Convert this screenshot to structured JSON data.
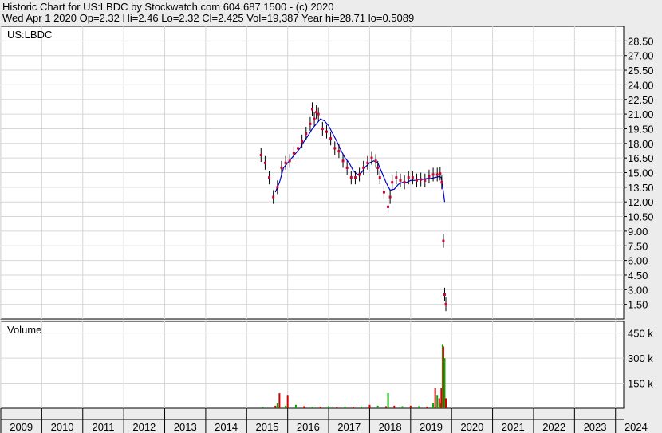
{
  "header": {
    "line1": "Historic Chart for US:LBDC by Stockwatch.com 604.687.1500 - (c) 2020",
    "line2": "Wed Apr  1 2020  Op=2.32  Hi=2.46  Lo=2.32  Cl=2.425  Vol=19,387  Year hi=28.71  lo=0.5089"
  },
  "chart_data": {
    "type": "line",
    "symbol_label": "US:LBDC",
    "volume_label": "Volume",
    "x_tick_labels": [
      "2009",
      "2010",
      "2011",
      "2012",
      "2013",
      "2014",
      "2015",
      "2016",
      "2017",
      "2018",
      "2019",
      "2020",
      "2021",
      "2022",
      "2023",
      "2024"
    ],
    "price_tick_labels": [
      "1.50",
      "3.00",
      "4.50",
      "6.00",
      "7.50",
      "9.00",
      "10.50",
      "12.00",
      "13.50",
      "15.00",
      "16.50",
      "18.00",
      "19.50",
      "21.00",
      "22.50",
      "24.00",
      "25.50",
      "27.00",
      "28.50"
    ],
    "price_ticks": [
      1.5,
      3,
      4.5,
      6,
      7.5,
      9,
      10.5,
      12,
      13.5,
      15,
      16.5,
      18,
      19.5,
      21,
      22.5,
      24,
      25.5,
      27,
      28.5
    ],
    "volume_tick_labels": [
      "150 k",
      "300 k",
      "450 k"
    ],
    "volume_ticks": [
      150000,
      300000,
      450000
    ],
    "x_range": [
      2009,
      2024.2
    ],
    "price_range": [
      0,
      30
    ],
    "volume_range": [
      0,
      520000
    ],
    "series": [
      {
        "name": "price",
        "color": "#000000",
        "x": [
          2015.35,
          2015.45,
          2015.55,
          2015.65,
          2015.75,
          2015.85,
          2015.95,
          2016.05,
          2016.15,
          2016.25,
          2016.35,
          2016.45,
          2016.55,
          2016.6,
          2016.65,
          2016.7,
          2016.75,
          2016.85,
          2016.95,
          2017.05,
          2017.15,
          2017.25,
          2017.35,
          2017.45,
          2017.55,
          2017.65,
          2017.75,
          2017.85,
          2017.95,
          2018.05,
          2018.15,
          2018.2,
          2018.25,
          2018.35,
          2018.45,
          2018.5,
          2018.55,
          2018.65,
          2018.75,
          2018.85,
          2018.95,
          2019.05,
          2019.15,
          2019.25,
          2019.35,
          2019.45,
          2019.55,
          2019.65,
          2019.72,
          2019.76,
          2019.8,
          2019.83,
          2019.86
        ],
        "values": [
          16.8,
          16.0,
          14.5,
          12.5,
          13.5,
          15.5,
          16.0,
          16.2,
          17.0,
          17.5,
          18.2,
          19.0,
          20.0,
          21.5,
          20.5,
          21.2,
          21.0,
          19.5,
          19.2,
          18.5,
          17.5,
          17.2,
          16.2,
          15.5,
          14.5,
          14.5,
          14.8,
          15.5,
          16.0,
          16.5,
          16.2,
          15.5,
          14.5,
          13.0,
          11.5,
          12.5,
          14.0,
          14.5,
          14.2,
          14.0,
          14.5,
          14.5,
          14.2,
          14.3,
          14.2,
          14.6,
          14.8,
          14.8,
          14.9,
          14.0,
          8.0,
          2.5,
          1.5
        ]
      },
      {
        "name": "moving-average",
        "color": "#0000cc",
        "x": [
          2015.7,
          2015.8,
          2015.9,
          2016.0,
          2016.1,
          2016.2,
          2016.3,
          2016.4,
          2016.5,
          2016.6,
          2016.7,
          2016.8,
          2016.9,
          2017.0,
          2017.1,
          2017.2,
          2017.3,
          2017.4,
          2017.5,
          2017.6,
          2017.7,
          2017.8,
          2017.9,
          2018.0,
          2018.1,
          2018.2,
          2018.3,
          2018.4,
          2018.5,
          2018.6,
          2018.7,
          2018.8,
          2018.9,
          2019.0,
          2019.1,
          2019.2,
          2019.3,
          2019.4,
          2019.5,
          2019.6,
          2019.7,
          2019.75,
          2019.8,
          2019.83
        ],
        "values": [
          13.0,
          14.0,
          15.5,
          16.0,
          16.5,
          17.0,
          17.5,
          18.2,
          18.8,
          19.5,
          20.0,
          20.5,
          20.3,
          19.8,
          19.0,
          18.2,
          17.3,
          16.5,
          16.0,
          15.2,
          14.8,
          15.0,
          15.6,
          16.0,
          16.2,
          16.0,
          15.0,
          14.0,
          13.2,
          13.3,
          13.8,
          14.0,
          14.0,
          14.2,
          14.2,
          14.3,
          14.3,
          14.4,
          14.4,
          14.5,
          14.6,
          14.5,
          13.0,
          12.0
        ]
      }
    ],
    "volume": {
      "x": [
        2015.4,
        2015.7,
        2015.75,
        2015.8,
        2015.95,
        2016.0,
        2016.2,
        2016.4,
        2016.6,
        2016.8,
        2017.0,
        2017.2,
        2017.4,
        2017.6,
        2017.8,
        2018.0,
        2018.2,
        2018.4,
        2018.45,
        2018.6,
        2018.8,
        2019.0,
        2019.2,
        2019.4,
        2019.55,
        2019.6,
        2019.65,
        2019.7,
        2019.72,
        2019.75,
        2019.78,
        2019.8,
        2019.83,
        2019.86
      ],
      "values": [
        8000,
        15000,
        30000,
        90000,
        15000,
        80000,
        20000,
        12000,
        10000,
        10000,
        12000,
        8000,
        10000,
        8000,
        10000,
        20000,
        15000,
        12000,
        90000,
        15000,
        12000,
        15000,
        12000,
        10000,
        30000,
        120000,
        80000,
        60000,
        30000,
        120000,
        380000,
        370000,
        300000,
        60000
      ]
    }
  },
  "colors": {
    "background": "#ffffff",
    "grid": "#d6d6d6",
    "border": "#000000",
    "price": "#000000",
    "moving_average": "#0000cc",
    "price_marks": "#cc0033",
    "volume_up": "#00aa00",
    "volume_down": "#cc0000"
  }
}
